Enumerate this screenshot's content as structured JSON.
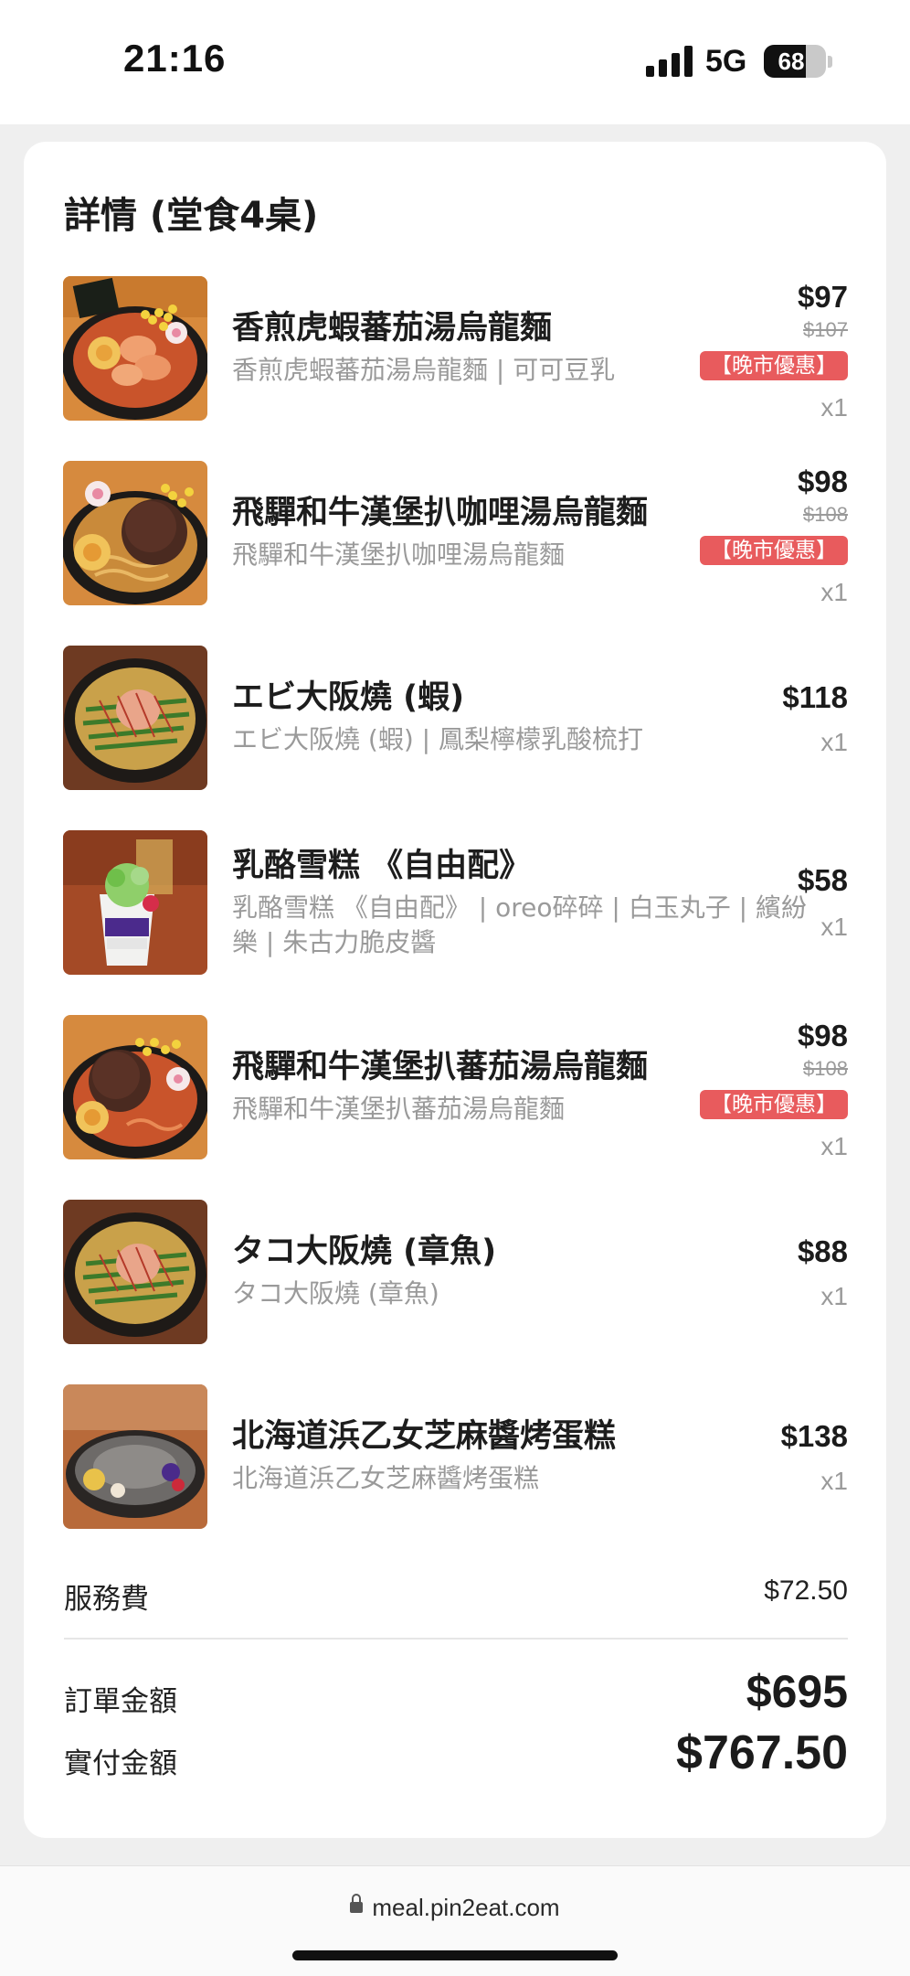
{
  "status_bar": {
    "time": "21:16",
    "network": "5G",
    "battery": "68",
    "battery_level": 0.68
  },
  "order": {
    "title": "詳情 (堂食4桌)",
    "items": [
      {
        "name": "香煎虎蝦蕃茄湯烏龍麵",
        "desc": "香煎虎蝦蕃茄湯烏龍麵 | 可可豆乳",
        "price": "$97",
        "original_price": "$107",
        "badge": "【晚市優惠】",
        "qty": "x1",
        "thumb_icon": "tomato-udon-photo"
      },
      {
        "name": "飛驒和牛漢堡扒咖哩湯烏龍麵",
        "desc": "飛驒和牛漢堡扒咖哩湯烏龍麵",
        "price": "$98",
        "original_price": "$108",
        "badge": "【晚市優惠】",
        "qty": "x1",
        "thumb_icon": "curry-udon-photo"
      },
      {
        "name": "エビ大阪燒 (蝦)",
        "desc": "エビ大阪燒 (蝦) | 鳳梨檸檬乳酸梳打",
        "price": "$118",
        "qty": "x1",
        "thumb_icon": "okonomiyaki-photo"
      },
      {
        "name": "乳酪雪糕 《自由配》",
        "desc": "乳酪雪糕 《自由配》 | oreo碎碎 | 白玉丸子 | 繽紛樂 | 朱古力脆皮醬",
        "price": "$58",
        "qty": "x1",
        "thumb_icon": "parfait-photo"
      },
      {
        "name": "飛驒和牛漢堡扒蕃茄湯烏龍麵",
        "desc": "飛驒和牛漢堡扒蕃茄湯烏龍麵",
        "price": "$98",
        "original_price": "$108",
        "badge": "【晚市優惠】",
        "qty": "x1",
        "thumb_icon": "hamburg-udon-photo"
      },
      {
        "name": "タコ大阪燒 (章魚)",
        "desc": "タコ大阪燒 (章魚)",
        "price": "$88",
        "qty": "x1",
        "thumb_icon": "okonomiyaki-photo"
      },
      {
        "name": "北海道浜乙女芝麻醬烤蛋糕",
        "desc": "北海道浜乙女芝麻醬烤蛋糕",
        "price": "$138",
        "qty": "x1",
        "thumb_icon": "sesame-cake-photo"
      }
    ],
    "service_fee_label": "服務費",
    "service_fee": "$72.50",
    "subtotal_label": "訂單金額",
    "subtotal": "$695",
    "total_label": "實付金額",
    "total": "$767.50"
  },
  "browser": {
    "url": "meal.pin2eat.com"
  }
}
